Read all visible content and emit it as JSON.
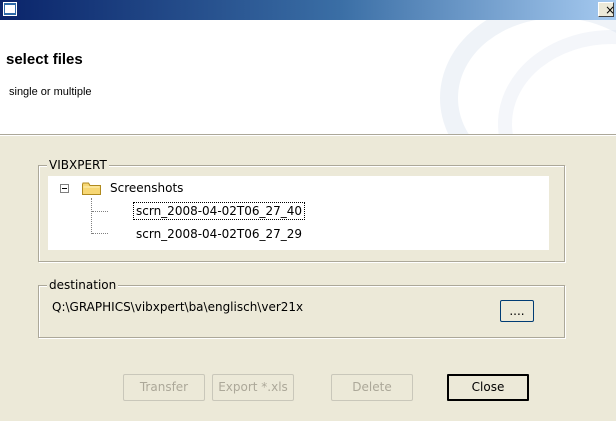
{
  "window": {
    "title": "",
    "close_glyph": "×"
  },
  "header": {
    "title": "select files",
    "subtitle": "single or multiple"
  },
  "source": {
    "group_label": "VIBXPERT",
    "tree": {
      "root": {
        "label": "Screenshots",
        "icon": "folder-icon",
        "expanded": true
      },
      "items": [
        {
          "label": "scrn_2008-04-02T06_27_40",
          "focused": true
        },
        {
          "label": "scrn_2008-04-02T06_27_29",
          "focused": false
        }
      ]
    }
  },
  "destination": {
    "group_label": "destination",
    "path": "Q:\\GRAPHICS\\vibxpert\\ba\\englisch\\ver21x",
    "browse_label": "...."
  },
  "buttons": {
    "transfer": {
      "label": "Transfer",
      "enabled": false
    },
    "export": {
      "label": "Export *.xls",
      "enabled": false
    },
    "delete": {
      "label": "Delete",
      "enabled": false
    },
    "close": {
      "label": "Close",
      "enabled": true
    }
  },
  "colors": {
    "titlebar_start": "#0a246a",
    "titlebar_end": "#a6caf0",
    "dialog_background": "#ece9d8",
    "disabled_text": "#aca899",
    "folder_yellow": "#f7d774"
  }
}
